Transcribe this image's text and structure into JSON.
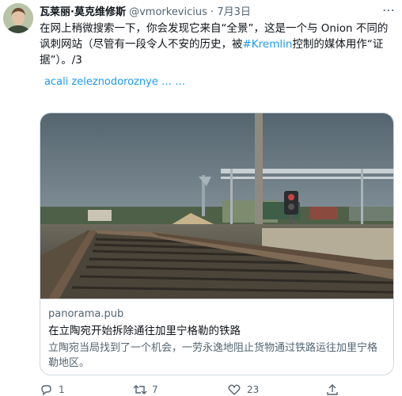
{
  "tweet": {
    "author_name": "瓦莱丽·莫克维修斯",
    "author_handle": "@vmorkevicius",
    "separator": "·",
    "date": "7月3日",
    "more_label": "⋯",
    "text_part1": "在网上稍微搜索一下，你会发现它来自“全景”，这是一个与 Onion 不同的讽刺网站（尽管有一段令人不安的历史，被",
    "hashtag": "#Kremlin",
    "text_part2": "控制的媒体用作“证据”）。/3",
    "translate_text": "acali  zeleznodoroznye … …"
  },
  "card": {
    "domain": "panorama.pub",
    "title": "在立陶宛开始拆除通往加里宁格勒的铁路",
    "description": "立陶宛当局找到了一个机会，一劳永逸地阻止货物通过铁路运往加里宁格勒地区。"
  },
  "actions": {
    "reply_count": "1",
    "retweet_count": "7",
    "like_count": "23",
    "icons": [
      "reply-icon",
      "retweet-icon",
      "like-icon",
      "share-icon"
    ]
  },
  "colors": {
    "link": "#1d9bf0",
    "secondary_text": "#536471",
    "border": "#cfd9de"
  }
}
